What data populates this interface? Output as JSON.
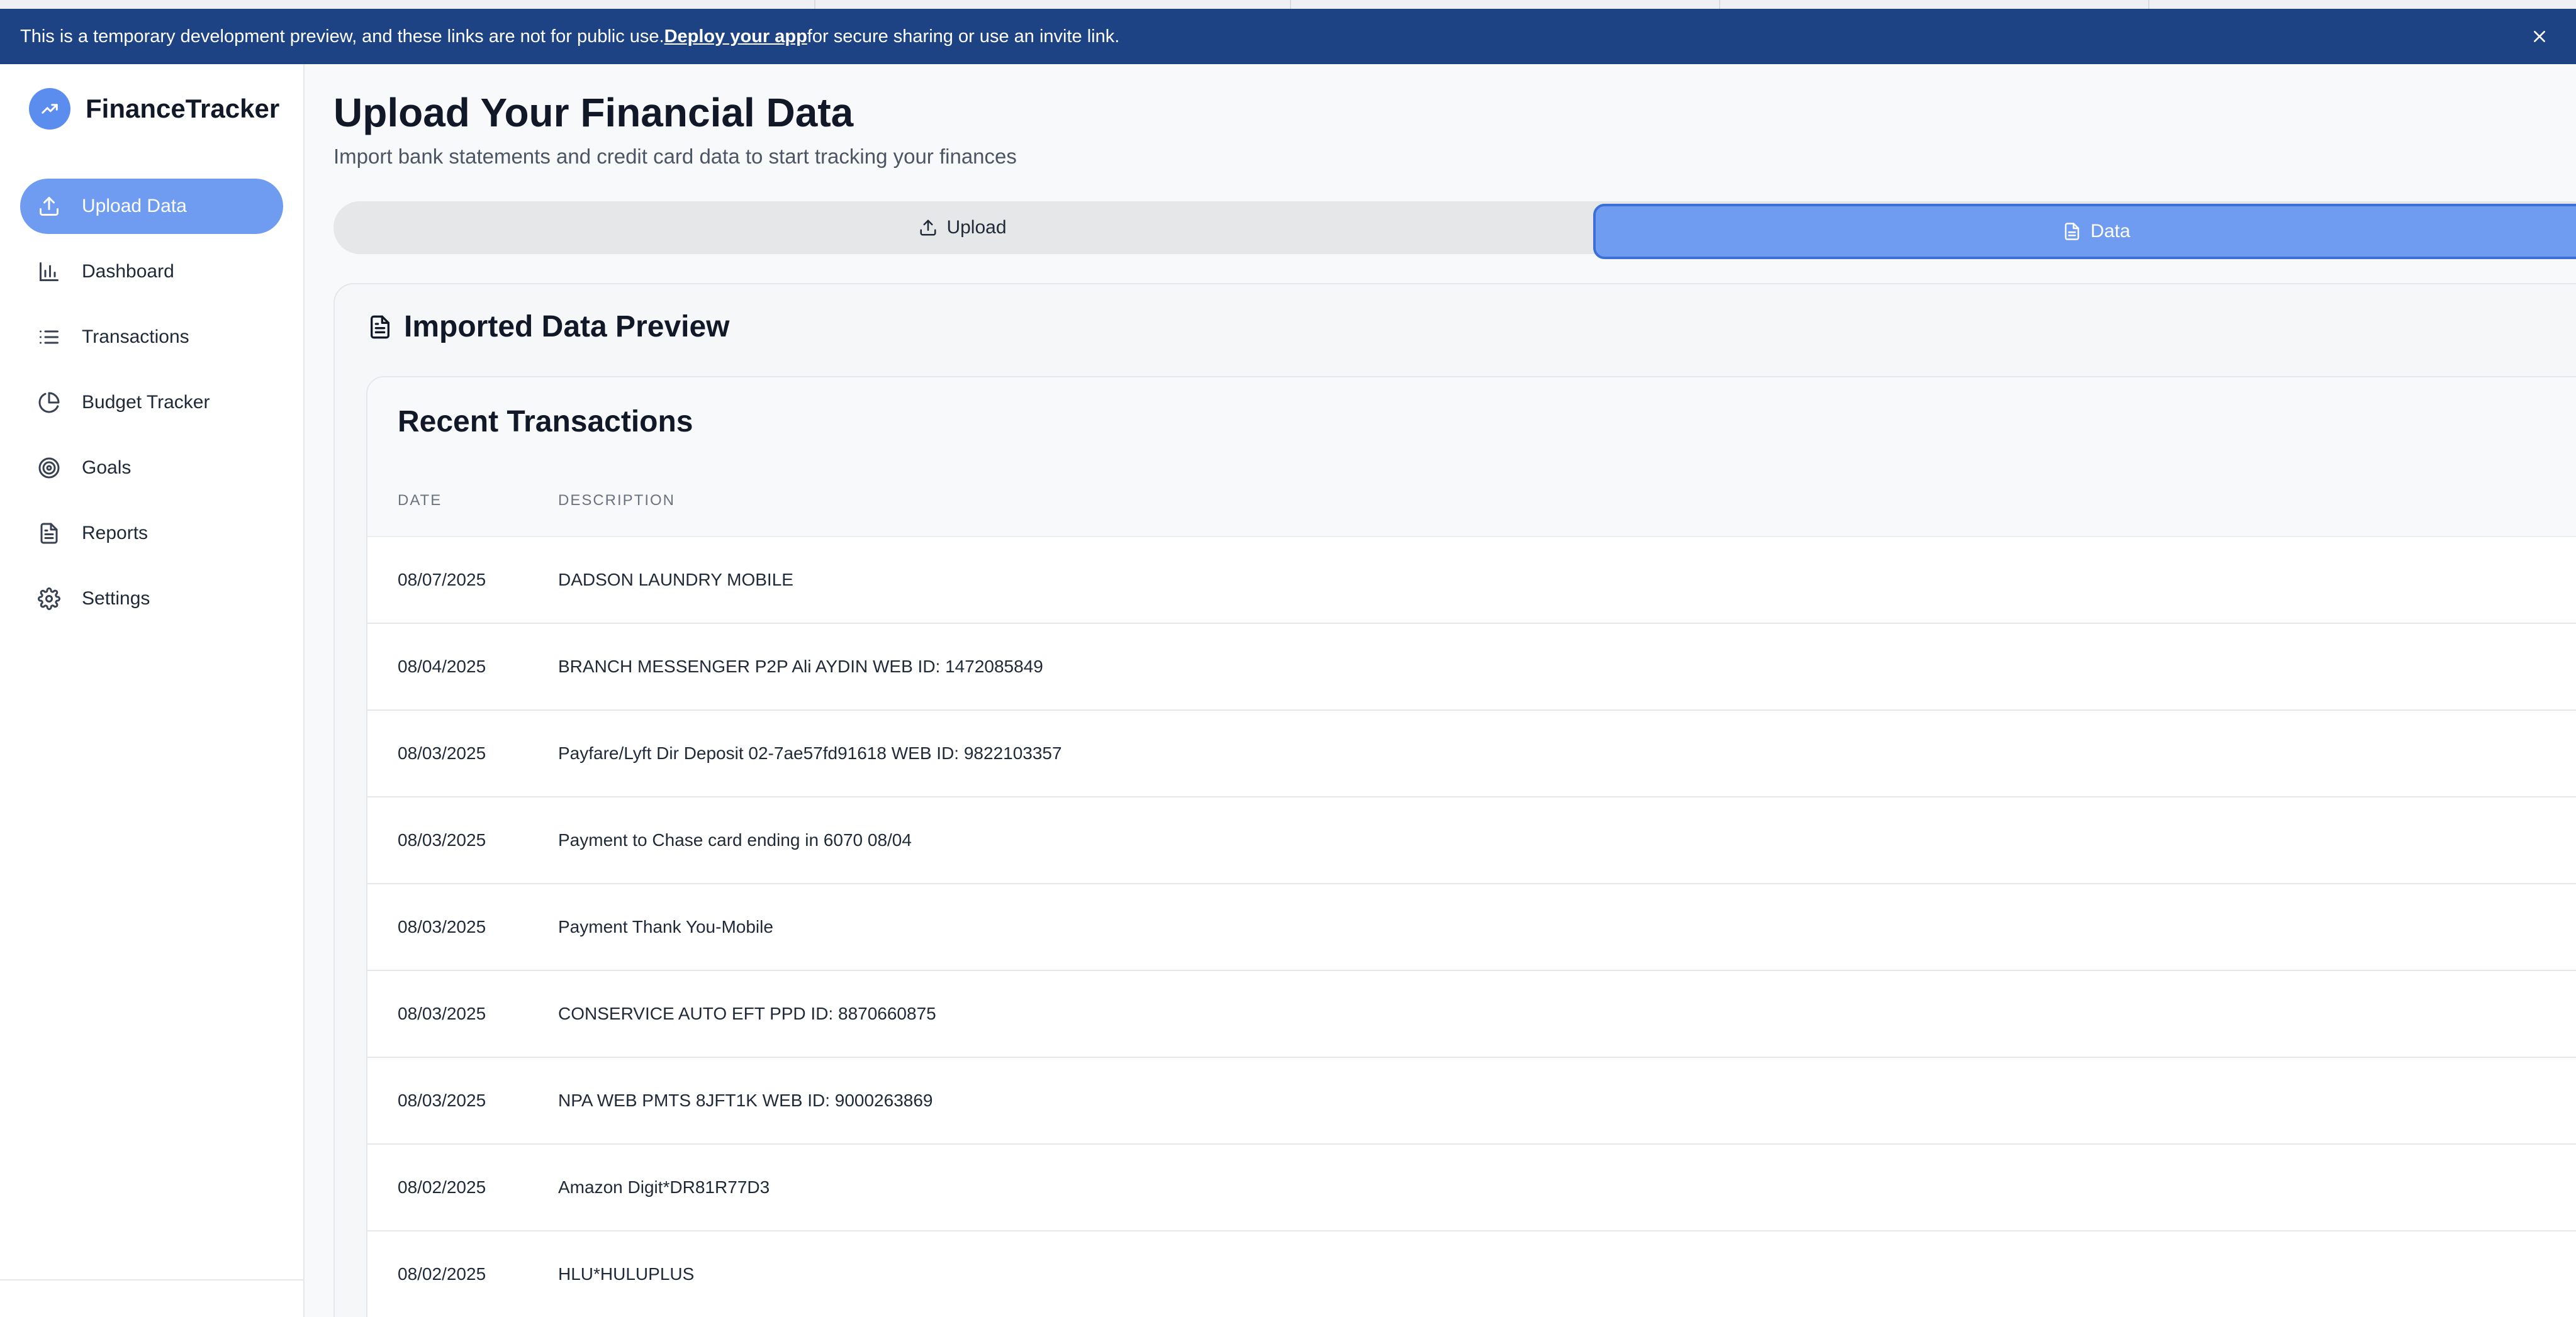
{
  "banner": {
    "text_before": "This is a temporary development preview, and these links are not for public use. ",
    "link": "Deploy your app",
    "text_after": " for secure sharing or use an invite link.",
    "close_icon": "close-icon"
  },
  "brand": {
    "name": "FinanceTracker",
    "logo_icon": "trending-up-icon"
  },
  "sidebar": {
    "items": [
      {
        "label": "Upload Data",
        "icon": "upload-icon",
        "active": true
      },
      {
        "label": "Dashboard",
        "icon": "bar-chart-icon",
        "active": false
      },
      {
        "label": "Transactions",
        "icon": "list-icon",
        "active": false
      },
      {
        "label": "Budget Tracker",
        "icon": "pie-chart-icon",
        "active": false
      },
      {
        "label": "Goals",
        "icon": "target-icon",
        "active": false
      },
      {
        "label": "Reports",
        "icon": "file-text-icon",
        "active": false
      },
      {
        "label": "Settings",
        "icon": "gear-icon",
        "active": false
      }
    ]
  },
  "page": {
    "title": "Upload Your Financial Data",
    "subtitle": "Import bank statements and credit card data to start tracking your finances"
  },
  "tabs": {
    "upload": "Upload",
    "data": "Data",
    "active": "data"
  },
  "preview": {
    "title": "Imported Data Preview",
    "section_title": "Recent Transactions",
    "columns": [
      "DATE",
      "DESCRIPTION"
    ],
    "rows": [
      {
        "date": "08/07/2025",
        "description": "DADSON LAUNDRY MOBILE"
      },
      {
        "date": "08/04/2025",
        "description": "BRANCH MESSENGER P2P Ali AYDIN WEB ID: 1472085849"
      },
      {
        "date": "08/03/2025",
        "description": "Payfare/Lyft Dir Deposit 02-7ae57fd91618 WEB ID: 9822103357"
      },
      {
        "date": "08/03/2025",
        "description": "Payment to Chase card ending in 6070 08/04"
      },
      {
        "date": "08/03/2025",
        "description": "Payment Thank You-Mobile"
      },
      {
        "date": "08/03/2025",
        "description": "CONSERVICE AUTO EFT PPD ID: 8870660875"
      },
      {
        "date": "08/03/2025",
        "description": "NPA WEB PMTS 8JFT1K WEB ID: 9000263869"
      },
      {
        "date": "08/02/2025",
        "description": "Amazon Digit*DR81R77D3"
      },
      {
        "date": "08/02/2025",
        "description": "HLU*HULUPLUS"
      }
    ]
  },
  "colors": {
    "banner_bg": "#1d4384",
    "accent": "#6f9cf0",
    "brand_logo": "#5b8def"
  }
}
